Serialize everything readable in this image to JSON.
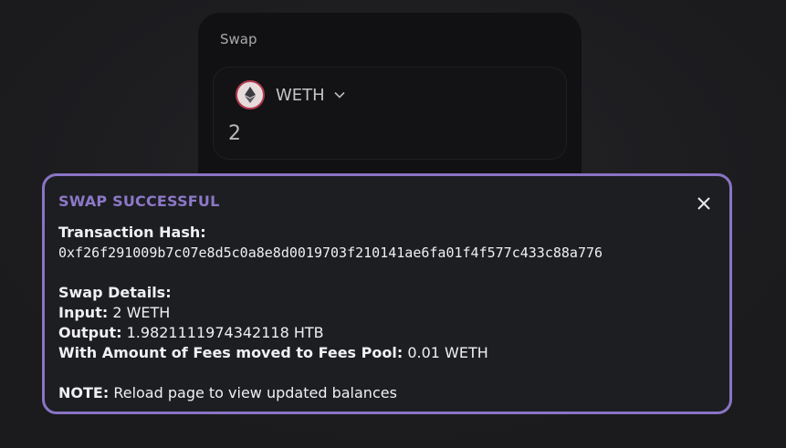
{
  "swap_card": {
    "title": "Swap",
    "token_symbol": "WETH",
    "amount": "2"
  },
  "toast": {
    "title": "SWAP SUCCESSFUL",
    "tx_hash_label": "Transaction Hash:",
    "tx_hash": "0xf26f291009b7c07e8d5c0a8e8d0019703f210141ae6fa01f4f577c433c88a776",
    "details_label": "Swap Details:",
    "input_label": "Input:",
    "input_value": "2 WETH",
    "output_label": "Output:",
    "output_value": "1.9821111974342118 HTB",
    "fees_label": "With Amount of Fees moved to Fees Pool:",
    "fees_value": "0.01 WETH",
    "note_label": "NOTE:",
    "note_value": "Reload page to view updated balances"
  },
  "colors": {
    "accent": "#8a74c4",
    "toast_bg": "#1d1e22",
    "card_bg": "#111113"
  },
  "icons": {
    "token": "ethereum-icon",
    "dropdown": "chevron-down-icon",
    "close": "close-icon"
  }
}
